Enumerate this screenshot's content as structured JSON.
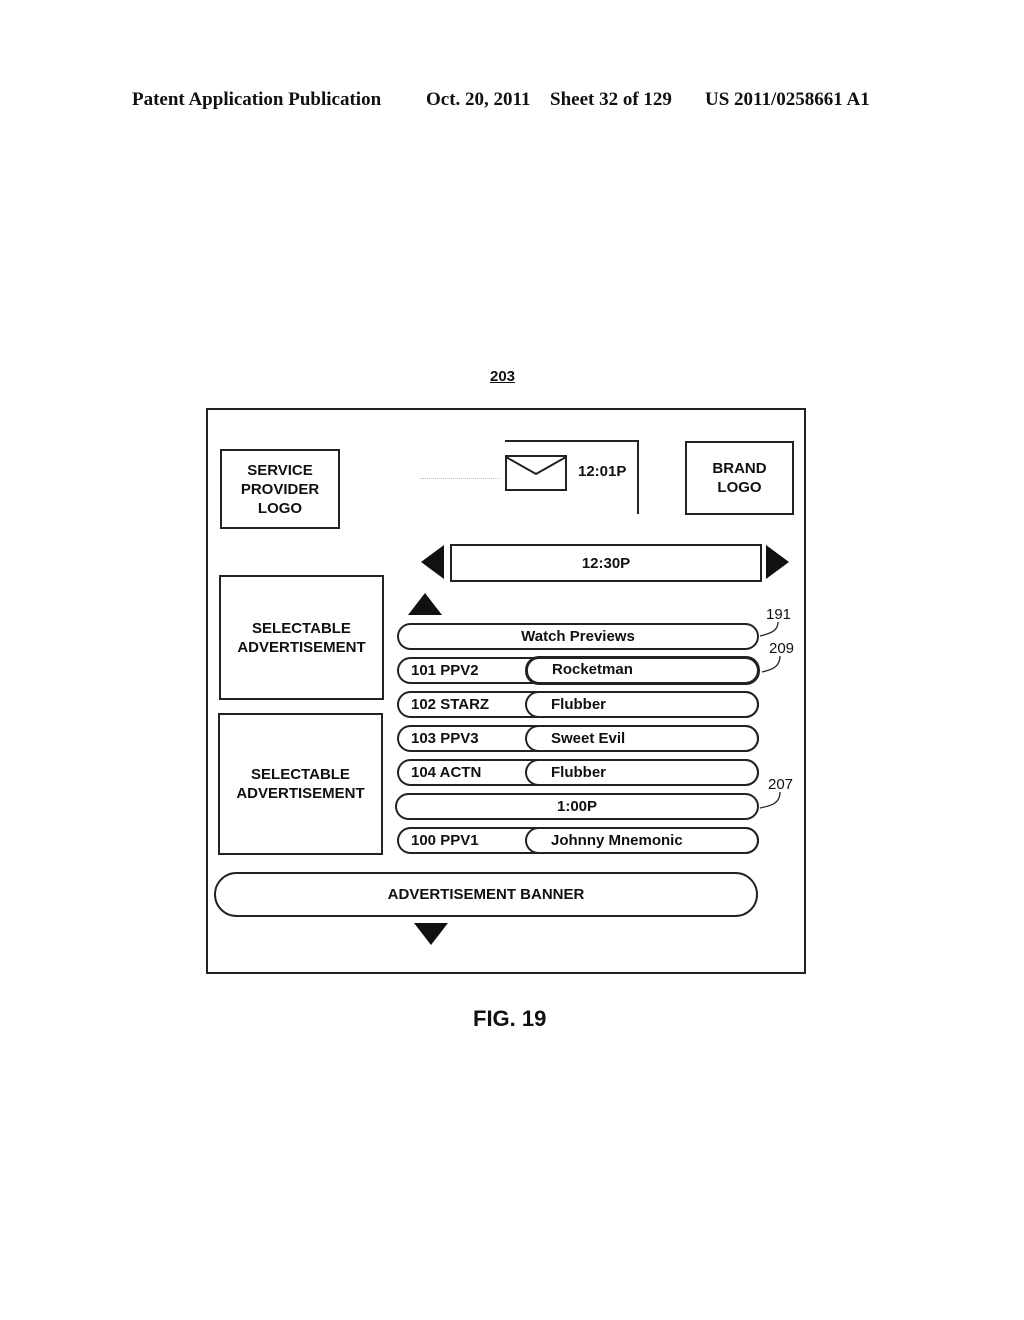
{
  "header": {
    "publication": "Patent Application Publication",
    "date": "Oct. 20, 2011",
    "sheet": "Sheet 32 of 129",
    "number": "US 2011/0258661 A1"
  },
  "figure": {
    "reference": "203",
    "caption": "FIG. 19"
  },
  "screen": {
    "service_provider_logo": "SERVICE PROVIDER LOGO",
    "service_provider_lines": [
      "SERVICE",
      "PROVIDER",
      "LOGO"
    ],
    "brand_logo_lines": [
      "BRAND",
      "LOGO"
    ],
    "mail_icon": "envelope-icon",
    "clock": "12:01P",
    "time_bar": "12:30P",
    "ads": [
      {
        "lines": [
          "SELECTABLE",
          "ADVERTISEMENT"
        ]
      },
      {
        "lines": [
          "SELECTABLE",
          "ADVERTISEMENT"
        ]
      }
    ],
    "watch_previews": "Watch Previews",
    "listings": [
      {
        "channel": "101 PPV2",
        "program": "Rocketman",
        "selected": true
      },
      {
        "channel": "102 STARZ",
        "program": "Flubber",
        "selected": false
      },
      {
        "channel": "103 PPV3",
        "program": "Sweet Evil",
        "selected": false
      },
      {
        "channel": "104 ACTN",
        "program": "Flubber",
        "selected": false
      }
    ],
    "time_divider": "1:00P",
    "listings_after": [
      {
        "channel": "100 PPV1",
        "program": "Johnny Mnemonic",
        "selected": false
      }
    ],
    "banner": "ADVERTISEMENT BANNER"
  },
  "reference_numerals": {
    "watch_previews": "191",
    "selected_listing": "209",
    "time_divider": "207"
  }
}
